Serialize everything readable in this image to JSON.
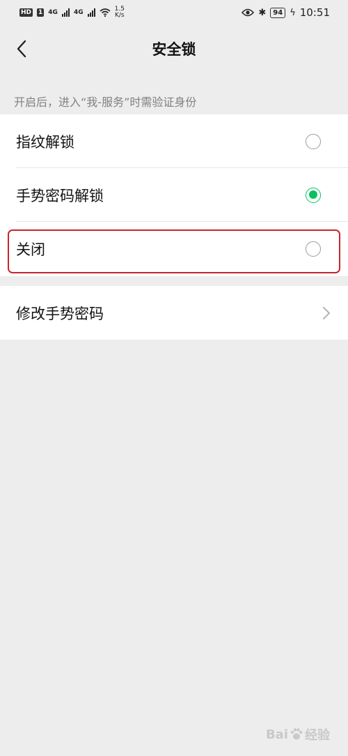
{
  "status_bar": {
    "hd_badge": "HD",
    "sim_number": "1",
    "network_1": "4G",
    "network_2": "4G",
    "speed_value": "1.5",
    "speed_unit": "K/s",
    "battery": "94",
    "time": "10:51",
    "icons": [
      "signal-icon",
      "wifi-icon",
      "eye-icon",
      "bluetooth-icon",
      "battery-icon",
      "charging-icon"
    ]
  },
  "nav": {
    "back_icon": "chevron-left-icon",
    "title": "安全锁"
  },
  "hint": "开启后，进入“我-服务”时需验证身份",
  "options": [
    {
      "label": "指纹解锁",
      "checked": false
    },
    {
      "label": "手势密码解锁",
      "checked": true
    },
    {
      "label": "关闭",
      "checked": false
    }
  ],
  "change_password": {
    "label": "修改手势密码",
    "icon": "chevron-right-icon"
  },
  "watermark": {
    "text_prefix": "Bai",
    "text_suffix": "经验"
  },
  "colors": {
    "accent_green": "#07c160",
    "highlight_red": "#c8252c",
    "background": "#ededed"
  }
}
